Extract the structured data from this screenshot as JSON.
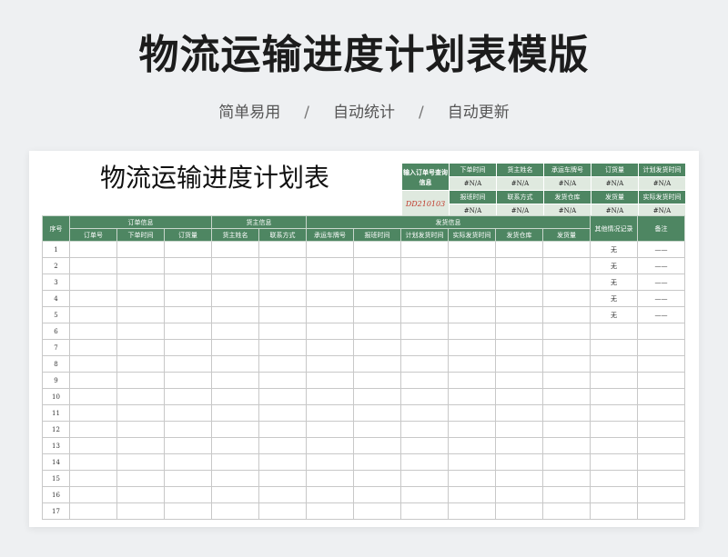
{
  "page": {
    "title": "物流运输进度计划表模版",
    "features": [
      "简单易用",
      "自动统计",
      "自动更新"
    ],
    "separator": "/"
  },
  "sheet": {
    "title": "物流运输进度计划表",
    "query_panel": {
      "input_label": "输入订单号查询信息",
      "order_no": "DD210103",
      "row1_headers": [
        "下单时间",
        "货主姓名",
        "承运车牌号",
        "订货量",
        "计划发货时间"
      ],
      "row1_values": [
        "#N/A",
        "#N/A",
        "#N/A",
        "#N/A",
        "#N/A"
      ],
      "row2_headers": [
        "报班时间",
        "联系方式",
        "发货仓库",
        "发货量",
        "实际发货时间"
      ],
      "row2_values": [
        "#N/A",
        "#N/A",
        "#N/A",
        "#N/A",
        "#N/A"
      ]
    },
    "table": {
      "seq_header": "序号",
      "groups": [
        "订单信息",
        "货主信息",
        "发货信息"
      ],
      "other_header": "其他情况记录",
      "remark_header": "备注",
      "sub_headers": [
        "订单号",
        "下单时间",
        "订货量",
        "货主姓名",
        "联系方式",
        "承运车牌号",
        "报班时间",
        "计划发货时间",
        "实际发货时间",
        "发货仓库",
        "发货量"
      ],
      "rows": [
        {
          "seq": "1",
          "other": "无",
          "remark": "——"
        },
        {
          "seq": "2",
          "other": "无",
          "remark": "——"
        },
        {
          "seq": "3",
          "other": "无",
          "remark": "——"
        },
        {
          "seq": "4",
          "other": "无",
          "remark": "——"
        },
        {
          "seq": "5",
          "other": "无",
          "remark": "——"
        },
        {
          "seq": "6",
          "other": "",
          "remark": ""
        },
        {
          "seq": "7",
          "other": "",
          "remark": ""
        },
        {
          "seq": "8",
          "other": "",
          "remark": ""
        },
        {
          "seq": "9",
          "other": "",
          "remark": ""
        },
        {
          "seq": "10",
          "other": "",
          "remark": ""
        },
        {
          "seq": "11",
          "other": "",
          "remark": ""
        },
        {
          "seq": "12",
          "other": "",
          "remark": ""
        },
        {
          "seq": "13",
          "other": "",
          "remark": ""
        },
        {
          "seq": "14",
          "other": "",
          "remark": ""
        },
        {
          "seq": "15",
          "other": "",
          "remark": ""
        },
        {
          "seq": "16",
          "other": "",
          "remark": ""
        },
        {
          "seq": "17",
          "other": "",
          "remark": ""
        }
      ]
    },
    "colors": {
      "header_green": "#4e8662",
      "value_green": "#dfe9df",
      "order_red": "#c0392b"
    }
  }
}
